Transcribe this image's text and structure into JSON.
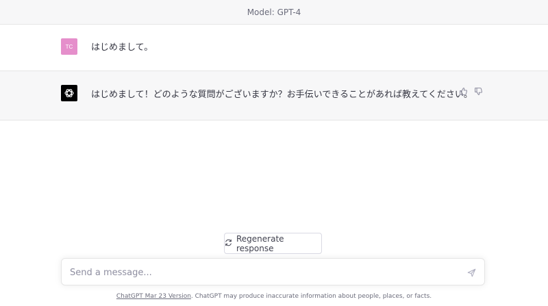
{
  "header": {
    "model_label": "Model: GPT-4"
  },
  "conversation": {
    "user_message": {
      "avatar_initials": "TC",
      "text": "はじめまして。"
    },
    "assistant_message": {
      "text": "はじめまして！どのような質問がございますか？お手伝いできることがあれば教えてください。"
    }
  },
  "actions": {
    "regenerate_label": "Regenerate response"
  },
  "composer": {
    "placeholder": "Send a message..."
  },
  "footer": {
    "version_link": "ChatGPT Mar 23 Version",
    "disclaimer": ". ChatGPT may produce inaccurate information about people, places, or facts."
  },
  "colors": {
    "user_avatar": "#e58fcb",
    "bot_avatar": "#000000",
    "alt_background": "#f7f7f8",
    "text": "#343541"
  },
  "icons": {
    "bot_avatar": "openai-logo-icon",
    "thumbs_up": "thumbs-up-icon",
    "thumbs_down": "thumbs-down-icon",
    "regenerate": "refresh-icon",
    "send": "send-icon"
  }
}
